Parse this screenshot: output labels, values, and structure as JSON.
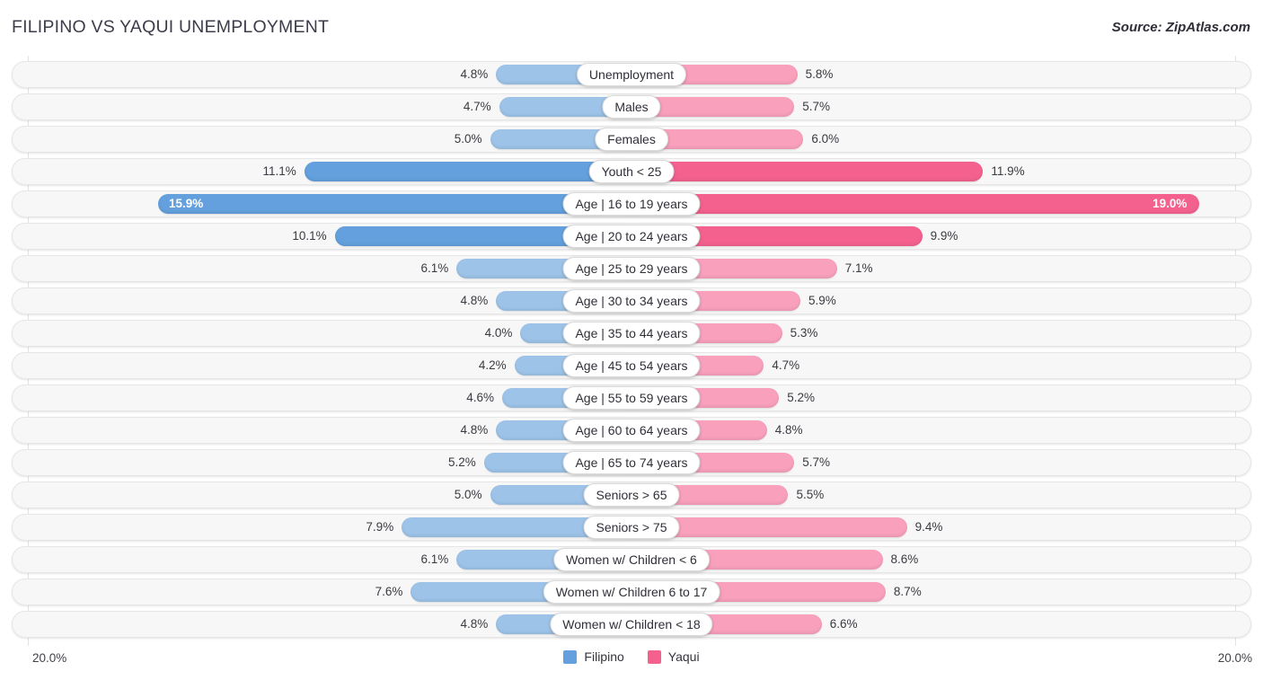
{
  "header": {
    "title": "FILIPINO VS YAQUI UNEMPLOYMENT",
    "source": "Source: ZipAtlas.com"
  },
  "axis": {
    "left_label": "20.0%",
    "right_label": "20.0%"
  },
  "legend": {
    "items": [
      {
        "label": "Filipino",
        "color": "#63a0dd"
      },
      {
        "label": "Yaqui",
        "color": "#f4618f"
      }
    ]
  },
  "colors": {
    "filipino_light": "#9dc3e8",
    "filipino_dark": "#63a0dd",
    "yaqui_light": "#f8a0bc",
    "yaqui_dark": "#f4618f",
    "track": "#f7f7f7",
    "gridline": "#e3e3e6"
  },
  "chart_data": {
    "type": "bar",
    "title": "FILIPINO VS YAQUI UNEMPLOYMENT",
    "subtitle": "Source: ZipAtlas.com",
    "orientation": "horizontal-diverging",
    "xlabel": "",
    "ylabel": "",
    "xlim": [
      0,
      20
    ],
    "axis_max_percent": 20.0,
    "grid": false,
    "legend_position": "bottom-center",
    "categories": [
      "Unemployment",
      "Males",
      "Females",
      "Youth < 25",
      "Age | 16 to 19 years",
      "Age | 20 to 24 years",
      "Age | 25 to 29 years",
      "Age | 30 to 34 years",
      "Age | 35 to 44 years",
      "Age | 45 to 54 years",
      "Age | 55 to 59 years",
      "Age | 60 to 64 years",
      "Age | 65 to 74 years",
      "Seniors > 65",
      "Seniors > 75",
      "Women w/ Children < 6",
      "Women w/ Children 6 to 17",
      "Women w/ Children < 18"
    ],
    "series": [
      {
        "name": "Filipino",
        "side": "left",
        "color": "#9dc3e8",
        "values": [
          4.8,
          4.7,
          5.0,
          11.1,
          15.9,
          10.1,
          6.1,
          4.8,
          4.0,
          4.2,
          4.6,
          4.8,
          5.2,
          5.0,
          7.9,
          6.1,
          7.6,
          4.8
        ],
        "labels": [
          "4.8%",
          "4.7%",
          "5.0%",
          "11.1%",
          "15.9%",
          "10.1%",
          "6.1%",
          "4.8%",
          "4.0%",
          "4.2%",
          "4.6%",
          "4.8%",
          "5.2%",
          "5.0%",
          "7.9%",
          "6.1%",
          "7.6%",
          "4.8%"
        ]
      },
      {
        "name": "Yaqui",
        "side": "right",
        "color": "#f8a0bc",
        "values": [
          5.8,
          5.7,
          6.0,
          11.9,
          19.0,
          9.9,
          7.1,
          5.9,
          5.3,
          4.7,
          5.2,
          4.8,
          5.7,
          5.5,
          9.4,
          8.6,
          8.7,
          6.6
        ],
        "labels": [
          "5.8%",
          "5.7%",
          "6.0%",
          "11.9%",
          "19.0%",
          "9.9%",
          "7.1%",
          "5.9%",
          "5.3%",
          "4.7%",
          "5.2%",
          "4.8%",
          "5.7%",
          "5.5%",
          "9.4%",
          "8.6%",
          "8.7%",
          "6.6%"
        ]
      }
    ],
    "rows": [
      {
        "label": "Unemployment",
        "left": 4.8,
        "left_text": "4.8%",
        "right": 5.8,
        "right_text": "5.8%",
        "emphasis": 0
      },
      {
        "label": "Males",
        "left": 4.7,
        "left_text": "4.7%",
        "right": 5.7,
        "right_text": "5.7%",
        "emphasis": 0
      },
      {
        "label": "Females",
        "left": 5.0,
        "left_text": "5.0%",
        "right": 6.0,
        "right_text": "6.0%",
        "emphasis": 0
      },
      {
        "label": "Youth < 25",
        "left": 11.1,
        "left_text": "11.1%",
        "right": 11.9,
        "right_text": "11.9%",
        "emphasis": 1
      },
      {
        "label": "Age | 16 to 19 years",
        "left": 15.9,
        "left_text": "15.9%",
        "right": 19.0,
        "right_text": "19.0%",
        "emphasis": 2
      },
      {
        "label": "Age | 20 to 24 years",
        "left": 10.1,
        "left_text": "10.1%",
        "right": 9.9,
        "right_text": "9.9%",
        "emphasis": 1
      },
      {
        "label": "Age | 25 to 29 years",
        "left": 6.1,
        "left_text": "6.1%",
        "right": 7.1,
        "right_text": "7.1%",
        "emphasis": 0
      },
      {
        "label": "Age | 30 to 34 years",
        "left": 4.8,
        "left_text": "4.8%",
        "right": 5.9,
        "right_text": "5.9%",
        "emphasis": 0
      },
      {
        "label": "Age | 35 to 44 years",
        "left": 4.0,
        "left_text": "4.0%",
        "right": 5.3,
        "right_text": "5.3%",
        "emphasis": 0
      },
      {
        "label": "Age | 45 to 54 years",
        "left": 4.2,
        "left_text": "4.2%",
        "right": 4.7,
        "right_text": "4.7%",
        "emphasis": 0
      },
      {
        "label": "Age | 55 to 59 years",
        "left": 4.6,
        "left_text": "4.6%",
        "right": 5.2,
        "right_text": "5.2%",
        "emphasis": 0
      },
      {
        "label": "Age | 60 to 64 years",
        "left": 4.8,
        "left_text": "4.8%",
        "right": 4.8,
        "right_text": "4.8%",
        "emphasis": 0
      },
      {
        "label": "Age | 65 to 74 years",
        "left": 5.2,
        "left_text": "5.2%",
        "right": 5.7,
        "right_text": "5.7%",
        "emphasis": 0
      },
      {
        "label": "Seniors > 65",
        "left": 5.0,
        "left_text": "5.0%",
        "right": 5.5,
        "right_text": "5.5%",
        "emphasis": 0
      },
      {
        "label": "Seniors > 75",
        "left": 7.9,
        "left_text": "7.9%",
        "right": 9.4,
        "right_text": "9.4%",
        "emphasis": 0
      },
      {
        "label": "Women w/ Children < 6",
        "left": 6.1,
        "left_text": "6.1%",
        "right": 8.6,
        "right_text": "8.6%",
        "emphasis": 0
      },
      {
        "label": "Women w/ Children 6 to 17",
        "left": 7.6,
        "left_text": "7.6%",
        "right": 8.7,
        "right_text": "8.7%",
        "emphasis": 0
      },
      {
        "label": "Women w/ Children < 18",
        "left": 4.8,
        "left_text": "4.8%",
        "right": 6.6,
        "right_text": "6.6%",
        "emphasis": 0
      }
    ]
  }
}
